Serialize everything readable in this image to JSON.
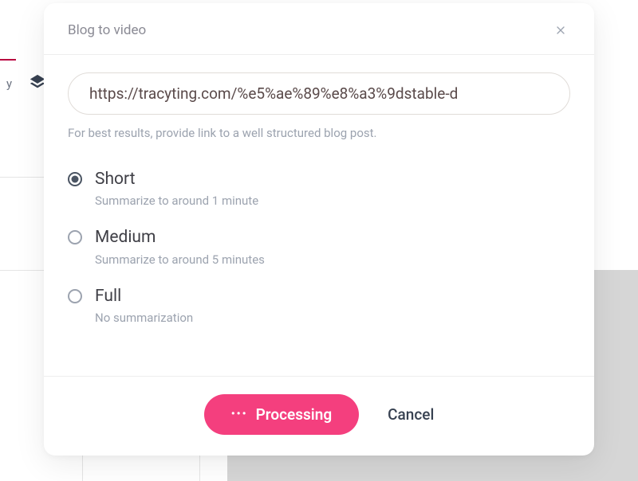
{
  "modal": {
    "title": "Blog to video",
    "url_value": "https://tracyting.com/%e5%ae%89%e8%a3%9dstable-d",
    "hint": "For best results, provide link to a well structured blog post.",
    "options": [
      {
        "label": "Short",
        "desc": "Summarize to around 1 minute",
        "selected": true
      },
      {
        "label": "Medium",
        "desc": "Summarize to around 5 minutes",
        "selected": false
      },
      {
        "label": "Full",
        "desc": "No summarization",
        "selected": false
      }
    ],
    "primary_button": "Processing",
    "secondary_button": "Cancel"
  },
  "background": {
    "left_label": "y"
  }
}
